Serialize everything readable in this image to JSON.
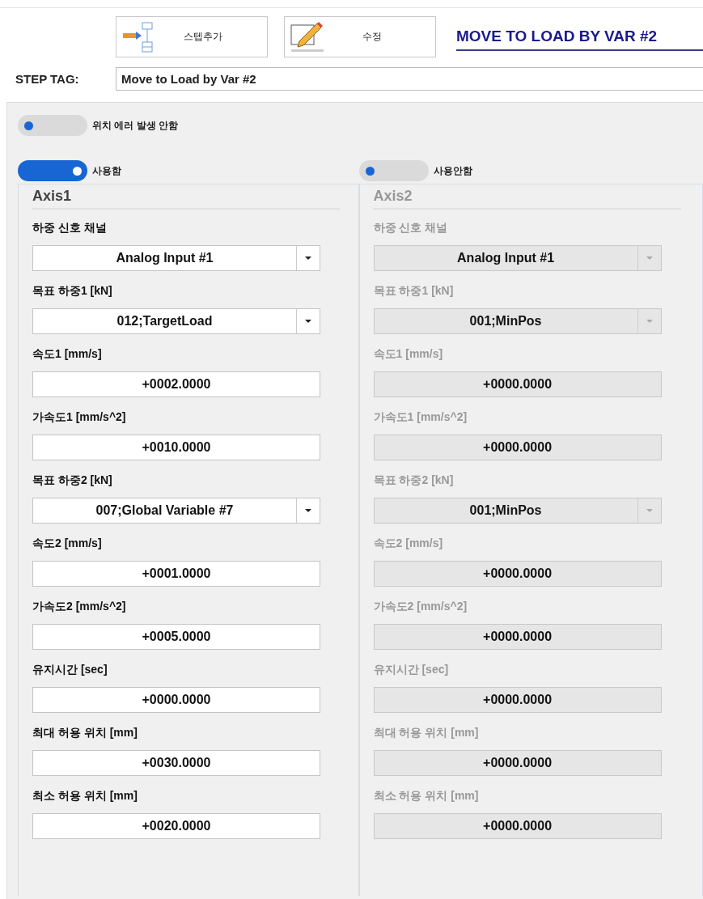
{
  "toolbar": {
    "buttons": [
      {
        "kind": "add-step",
        "label": "스텝추가"
      },
      {
        "kind": "edit",
        "label": "수정"
      }
    ],
    "title": "MOVE TO LOAD BY VAR #2"
  },
  "step_tag": {
    "label": "STEP TAG:",
    "value": "Move to Load by Var #2"
  },
  "error_toggle": {
    "label": "위치 에러 발생 안함",
    "on": false
  },
  "axes": [
    {
      "toggle_label": "사용함",
      "on": true,
      "title": "Axis1",
      "fields": [
        {
          "kind": "select",
          "label": "하중 신호 채널",
          "value": "Analog Input #1"
        },
        {
          "kind": "select",
          "label": "목표 하중1 [kN]",
          "value": "012;TargetLoad"
        },
        {
          "kind": "number",
          "label": "속도1 [mm/s]",
          "value": "+0002.0000"
        },
        {
          "kind": "number",
          "label": "가속도1 [mm/s^2]",
          "value": "+0010.0000"
        },
        {
          "kind": "select",
          "label": "목표 하중2 [kN]",
          "value": "007;Global Variable #7"
        },
        {
          "kind": "number",
          "label": "속도2 [mm/s]",
          "value": "+0001.0000"
        },
        {
          "kind": "number",
          "label": "가속도2 [mm/s^2]",
          "value": "+0005.0000"
        },
        {
          "kind": "number",
          "label": "유지시간 [sec]",
          "value": "+0000.0000"
        },
        {
          "kind": "number",
          "label": "최대 허용 위치 [mm]",
          "value": "+0030.0000"
        },
        {
          "kind": "number",
          "label": "최소 허용 위치 [mm]",
          "value": "+0020.0000"
        }
      ]
    },
    {
      "toggle_label": "사용안함",
      "on": false,
      "title": "Axis2",
      "fields": [
        {
          "kind": "select",
          "label": "하중 신호 채널",
          "value": "Analog Input #1"
        },
        {
          "kind": "select",
          "label": "목표 하중1 [kN]",
          "value": "001;MinPos"
        },
        {
          "kind": "number",
          "label": "속도1 [mm/s]",
          "value": "+0000.0000"
        },
        {
          "kind": "number",
          "label": "가속도1 [mm/s^2]",
          "value": "+0000.0000"
        },
        {
          "kind": "select",
          "label": "목표 하중2 [kN]",
          "value": "001;MinPos"
        },
        {
          "kind": "number",
          "label": "속도2 [mm/s]",
          "value": "+0000.0000"
        },
        {
          "kind": "number",
          "label": "가속도2 [mm/s^2]",
          "value": "+0000.0000"
        },
        {
          "kind": "number",
          "label": "유지시간 [sec]",
          "value": "+0000.0000"
        },
        {
          "kind": "number",
          "label": "최대 허용 위치 [mm]",
          "value": "+0000.0000"
        },
        {
          "kind": "number",
          "label": "최소 허용 위치 [mm]",
          "value": "+0000.0000"
        }
      ]
    }
  ]
}
